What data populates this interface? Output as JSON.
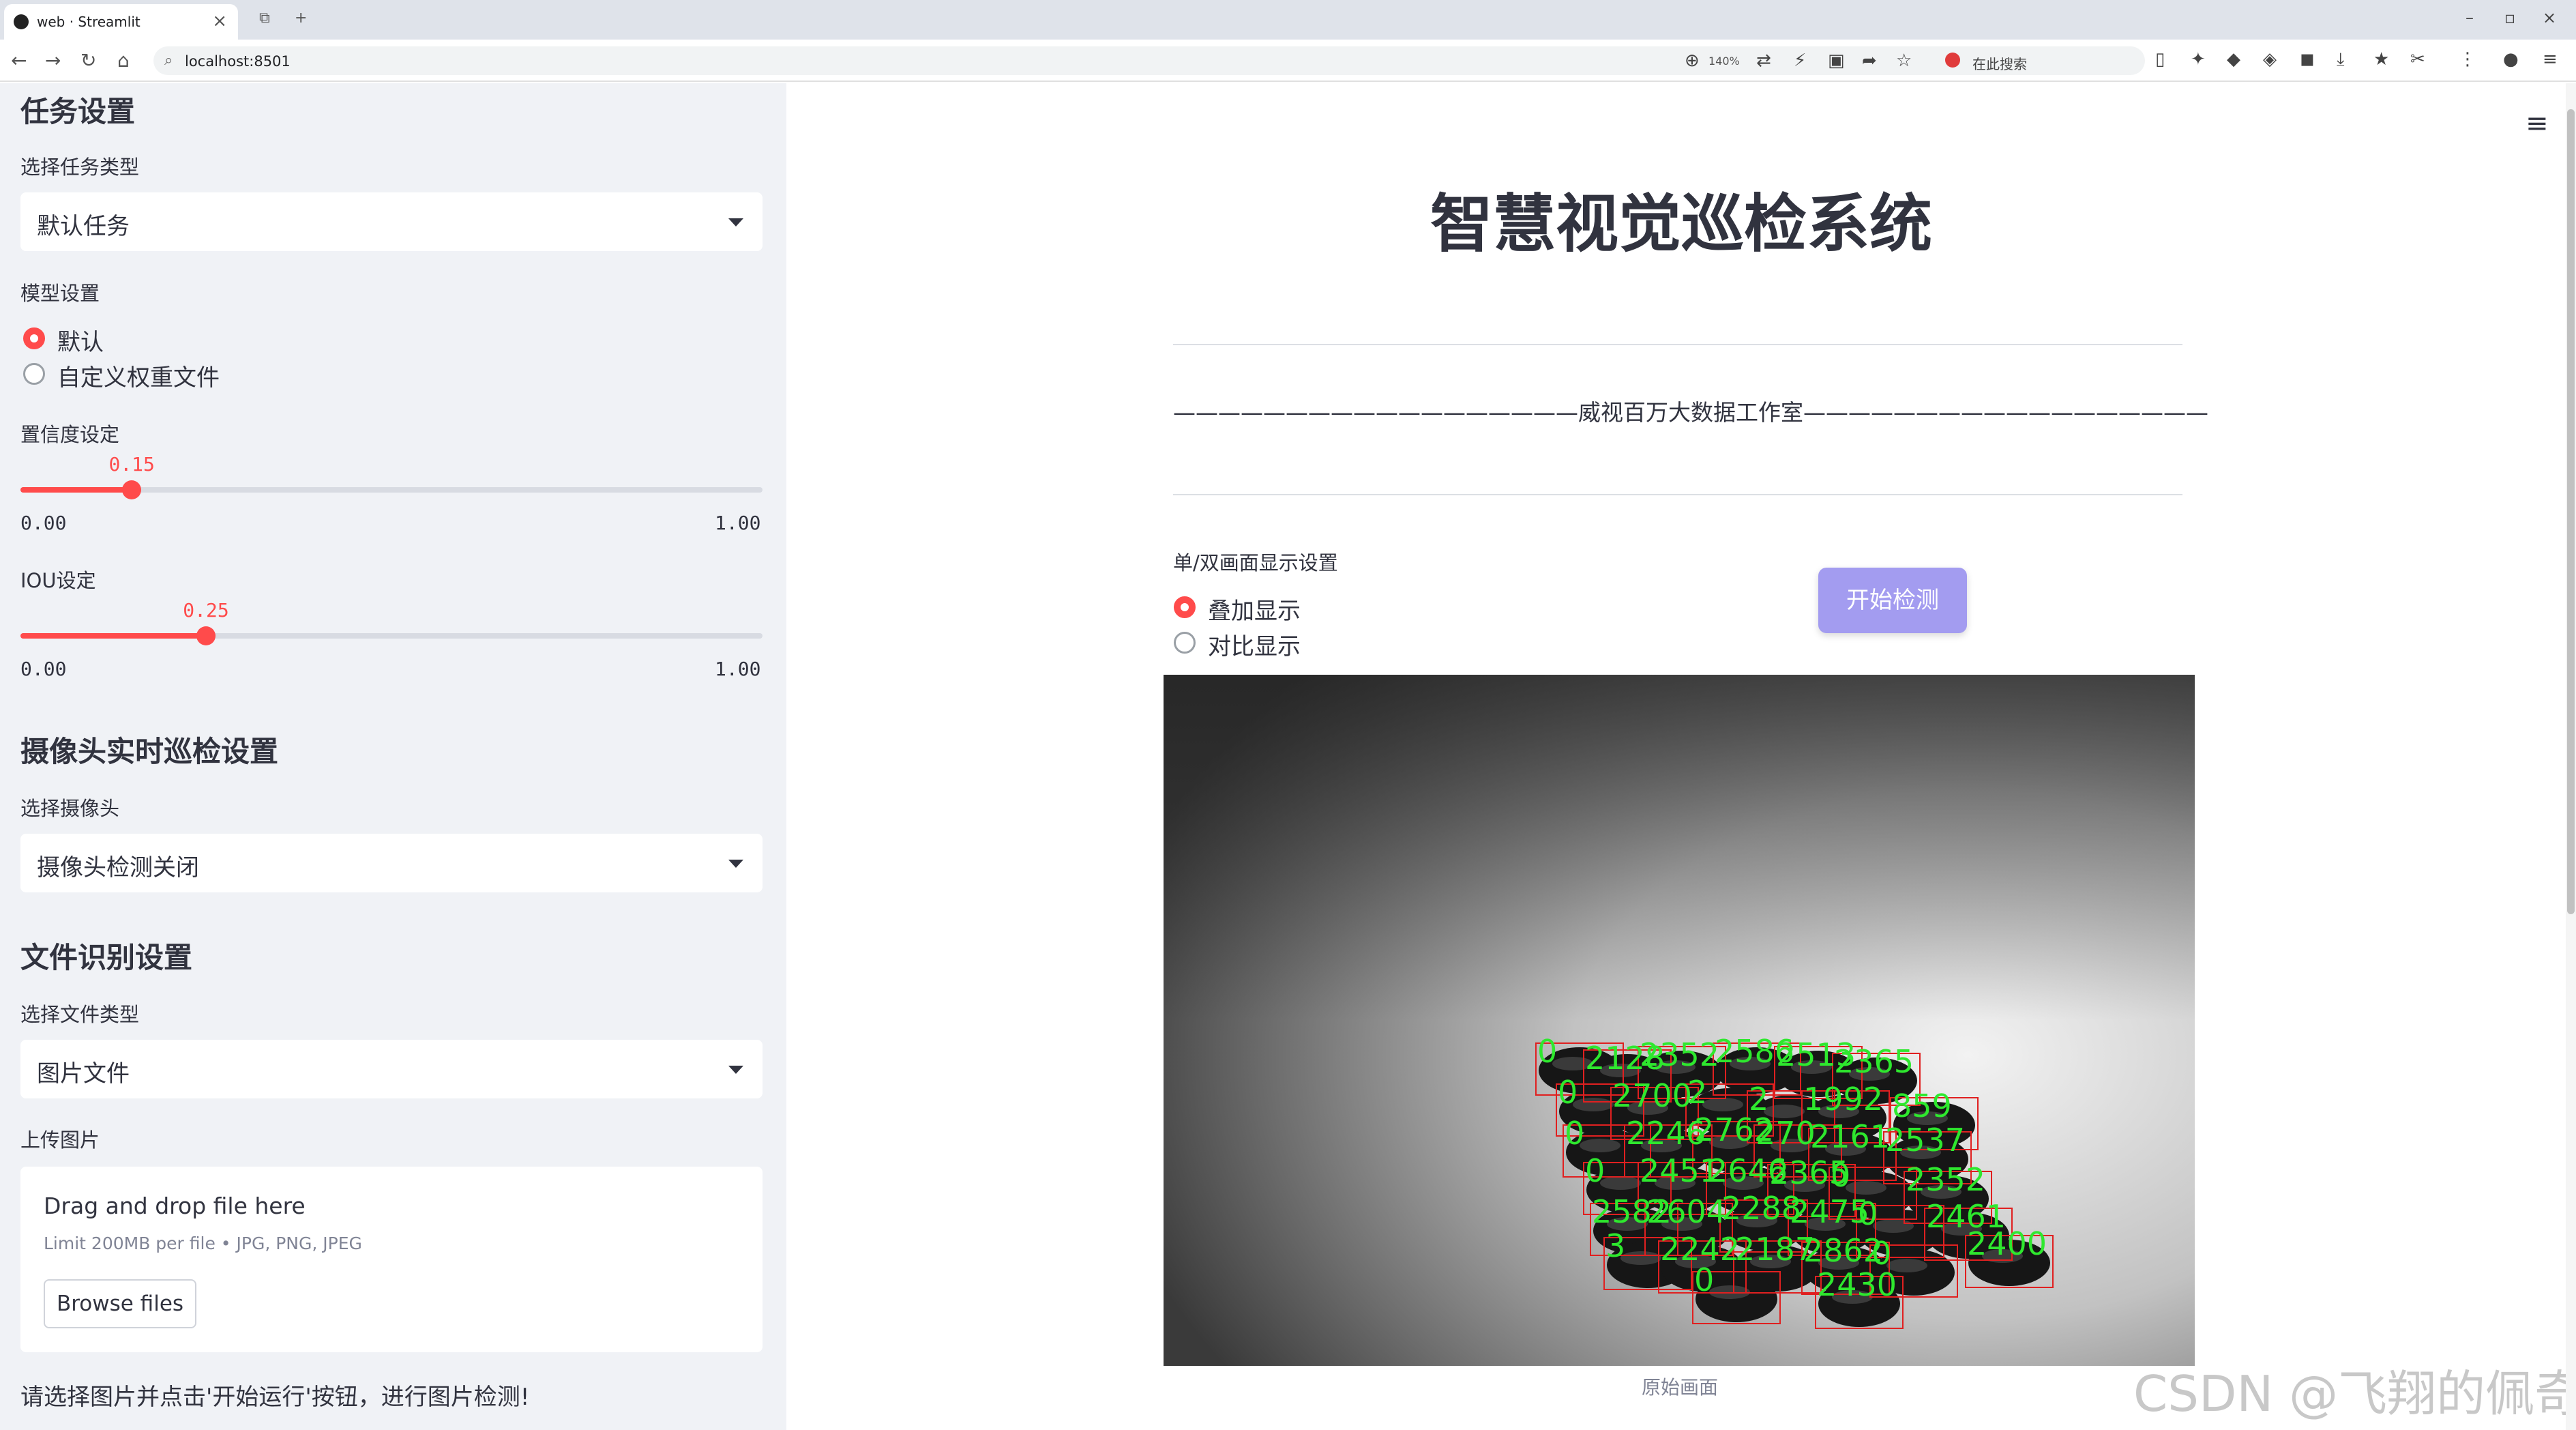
{
  "browser": {
    "tab_title": "web · Streamlit",
    "url": "localhost:8501",
    "zoom": "140%",
    "search_placeholder": "在此搜索"
  },
  "sidebar": {
    "task_heading": "任务设置",
    "task_type_label": "选择任务类型",
    "task_type_value": "默认任务",
    "model_label": "模型设置",
    "model_options": [
      "默认",
      "自定义权重文件"
    ],
    "model_selected": "默认",
    "conf_label": "置信度设定",
    "conf_value": "0.15",
    "conf_fraction": 0.15,
    "conf_min": "0.00",
    "conf_max": "1.00",
    "iou_label": "IOU设定",
    "iou_value": "0.25",
    "iou_fraction": 0.25,
    "iou_min": "0.00",
    "iou_max": "1.00",
    "camera_heading": "摄像头实时巡检设置",
    "camera_label": "选择摄像头",
    "camera_value": "摄像头检测关闭",
    "file_heading": "文件识别设置",
    "file_type_label": "选择文件类型",
    "file_type_value": "图片文件",
    "upload_label": "上传图片",
    "upload_title": "Drag and drop file here",
    "upload_limit": "Limit 200MB per file • JPG, PNG, JPEG",
    "browse_label": "Browse files",
    "note": "请选择图片并点击'开始运行'按钮，进行图片检测!"
  },
  "main": {
    "title": "智慧视觉巡检系统",
    "banner": "——————————————————威视百万大数据工作室——————————————————",
    "display_label": "单/双画面显示设置",
    "display_options": [
      "叠加显示",
      "对比显示"
    ],
    "display_selected": "叠加显示",
    "start_button": "开始检测",
    "image_caption": "原始画面",
    "watermark": "CSDN @飞翔的佩奇"
  },
  "detections": {
    "box_color": "#e02020",
    "label_color": "#2ee82e",
    "labels": [
      "0",
      "2128",
      "2352",
      "2586",
      "2513",
      "2365",
      "0",
      "2700",
      "2",
      "2",
      "1992",
      "859",
      "0",
      "2246",
      "2762",
      "270",
      "2161",
      "2537",
      "0",
      "2451",
      "2646",
      "2365",
      "0",
      "2352",
      "2582",
      "2604",
      "2288",
      "2475",
      "0",
      "2461",
      "3",
      "2242",
      "2187",
      "2862",
      "0",
      "2400",
      "0",
      "2430"
    ]
  },
  "colors": {
    "accent": "#ff4b4b",
    "sidebar_bg": "#f0f2f6",
    "start_button": "#a39cf0"
  }
}
